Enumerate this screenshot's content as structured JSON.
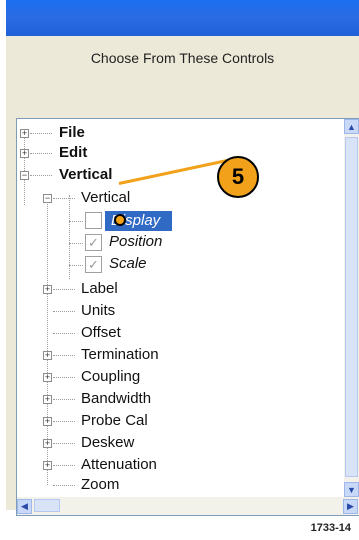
{
  "panel": {
    "heading": "Choose From These Controls"
  },
  "tree": {
    "file": "File",
    "edit": "Edit",
    "vertical": "Vertical",
    "vertical_child": "Vertical",
    "display": "Display",
    "position": "Position",
    "scale": "Scale",
    "label": "Label",
    "units": "Units",
    "offset": "Offset",
    "termination": "Termination",
    "coupling": "Coupling",
    "bandwidth": "Bandwidth",
    "probe_cal": "Probe Cal",
    "deskew": "Deskew",
    "attenuation": "Attenuation",
    "zoom": "Zoom"
  },
  "callout": {
    "number": "5"
  },
  "figure_id": "1733-14"
}
